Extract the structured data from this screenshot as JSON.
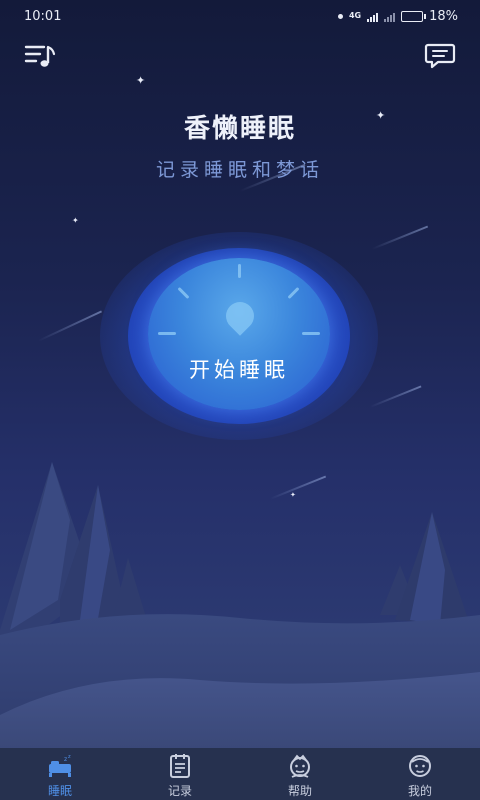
{
  "status_bar": {
    "time": "10:01",
    "network_type": "4G",
    "battery_percent": "18%",
    "battery_level": 0.18
  },
  "header": {
    "left_icon": "music-playlist-icon",
    "right_icon": "message-icon"
  },
  "app": {
    "title": "香懒睡眠",
    "subtitle": "记录睡眠和梦话"
  },
  "main": {
    "start_button_label": "开始睡眠"
  },
  "bottom_nav": {
    "items": [
      {
        "label": "睡眠",
        "icon": "bed-icon",
        "active": true
      },
      {
        "label": "记录",
        "icon": "notebook-icon",
        "active": false
      },
      {
        "label": "帮助",
        "icon": "help-face-icon",
        "active": false
      },
      {
        "label": "我的",
        "icon": "profile-face-icon",
        "active": false
      }
    ]
  },
  "colors": {
    "background_top": "#131a3a",
    "background_bottom": "#34437a",
    "accent": "#4f8fe6",
    "button": "#3b86dc",
    "subtitle": "#7d98d6",
    "nav_background": "#26314f"
  }
}
